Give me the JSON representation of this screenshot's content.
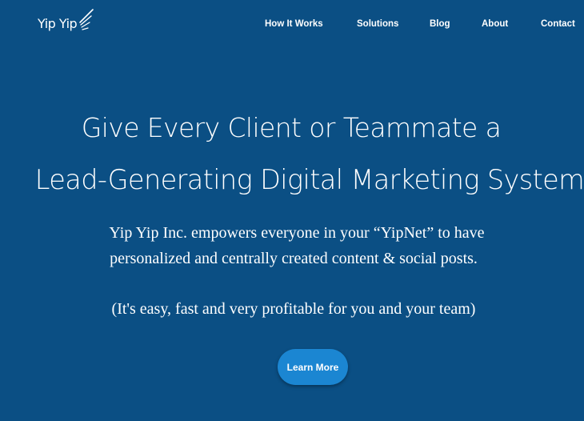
{
  "header": {
    "logo_text": "Yip Yip",
    "nav": [
      {
        "label": "How It Works"
      },
      {
        "label": "Solutions"
      },
      {
        "label": "Blog"
      },
      {
        "label": "About"
      },
      {
        "label": "Contact"
      }
    ]
  },
  "hero": {
    "title_line1": "Give Every Client or Teammate a",
    "title_line2": "Lead-Generating Digital Marketing System",
    "subtitle_line1": "Yip Yip Inc. empowers everyone in your “YipNet” to have",
    "subtitle_line2": "personalized and centrally created content & social posts.",
    "note": "(It's easy, fast and very profitable for you and your team)",
    "cta_label": "Learn More"
  },
  "colors": {
    "background": "#0b4f84",
    "cta": "#1b86d2",
    "text": "#ffffff"
  }
}
